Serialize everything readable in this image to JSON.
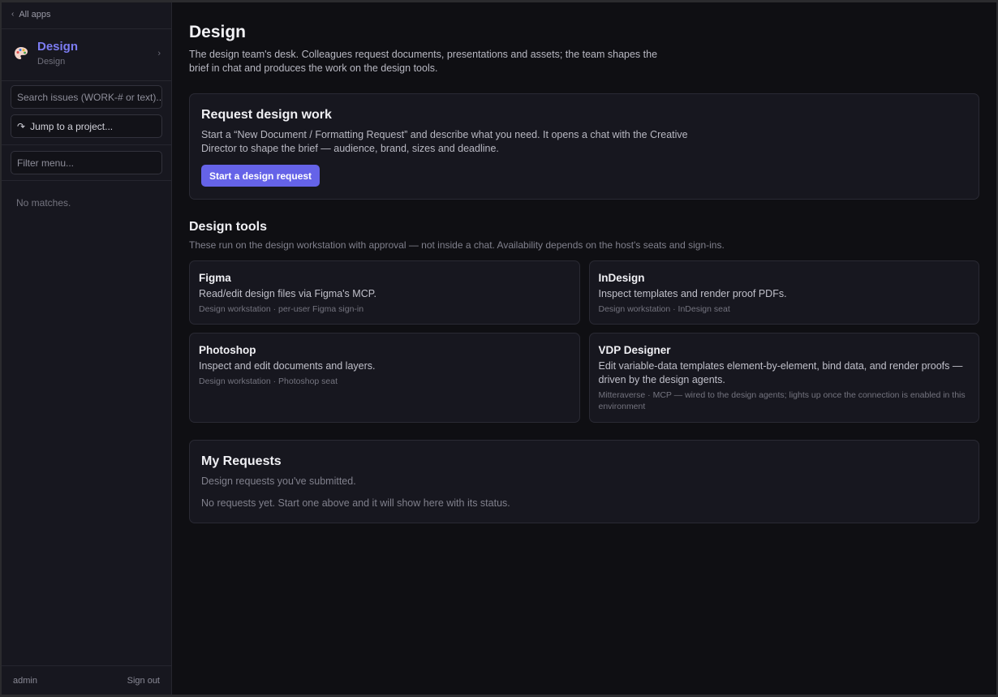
{
  "sidebar": {
    "back_label": "All apps",
    "app": {
      "title": "Design",
      "subtitle": "Design",
      "icon": "palette-icon"
    },
    "search": {
      "placeholder": "Search issues (WORK-# or text)..."
    },
    "jump": {
      "label": "Jump to a project..."
    },
    "filter": {
      "placeholder": "Filter menu..."
    },
    "no_matches": "No matches.",
    "footer": {
      "user": "admin",
      "sign_out": "Sign out"
    }
  },
  "main": {
    "title": "Design",
    "description": "The design team's desk. Colleagues request documents, presentations and assets; the team shapes the brief in chat and produces the work on the design tools.",
    "request_card": {
      "title": "Request design work",
      "description": "Start a “New Document / Formatting Request” and describe what you need. It opens a chat with the Creative Director to shape the brief — audience, brand, sizes and deadline.",
      "button": "Start a design request"
    },
    "tools": {
      "title": "Design tools",
      "description": "These run on the design workstation with approval — not inside a chat. Availability depends on the host's seats and sign-ins.",
      "items": [
        {
          "name": "Figma",
          "description": "Read/edit design files via Figma's MCP.",
          "meta": "Design workstation · per-user Figma sign-in"
        },
        {
          "name": "InDesign",
          "description": "Inspect templates and render proof PDFs.",
          "meta": "Design workstation · InDesign seat"
        },
        {
          "name": "Photoshop",
          "description": "Inspect and edit documents and layers.",
          "meta": "Design workstation · Photoshop seat"
        },
        {
          "name": "VDP Designer",
          "description": "Edit variable-data templates element-by-element, bind data, and render proofs — driven by the design agents.",
          "meta": "Mitteraverse · MCP — wired to the design agents; lights up once the connection is enabled in this environment"
        }
      ]
    },
    "my_requests": {
      "title": "My Requests",
      "subtitle": "Design requests you've submitted.",
      "empty": "No requests yet. Start one above and it will show here with its status."
    }
  },
  "colors": {
    "accent": "#6563e8",
    "app_title": "#7c7cf2",
    "background": "#0f0f13",
    "sidebar": "#17171f"
  }
}
